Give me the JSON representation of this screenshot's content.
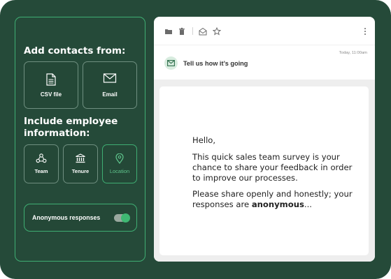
{
  "left_panel": {
    "add_contacts_title": "Add contacts from:",
    "sources": [
      {
        "label": "CSV file",
        "icon": "csv-file-icon"
      },
      {
        "label": "Email",
        "icon": "envelope-icon"
      }
    ],
    "employee_info_title": "Include employee information:",
    "fields": [
      {
        "label": "Team",
        "icon": "team-icon"
      },
      {
        "label": "Tenure",
        "icon": "building-icon"
      },
      {
        "label": "Location",
        "icon": "location-pin-icon",
        "selected": true
      }
    ],
    "anonymous": {
      "label": "Anonymous responses",
      "enabled": true
    }
  },
  "email": {
    "toolbar_icons": [
      "folder-icon",
      "trash-icon",
      "open-envelope-icon",
      "star-icon",
      "more-vertical-icon"
    ],
    "date": "Today, 11:00am",
    "subject": "Tell us how it’s going",
    "body": {
      "greeting": "Hello,",
      "paragraph1": "This quick sales team survey is your chance to share your feedback in order to improve our processes.",
      "paragraph2_prefix": "Please share openly and honestly; your responses are ",
      "paragraph2_bold": "anonymous",
      "paragraph2_suffix": "..."
    }
  },
  "colors": {
    "background": "#254a39",
    "accent_green": "#3fae73",
    "card_white": "#ffffff"
  }
}
